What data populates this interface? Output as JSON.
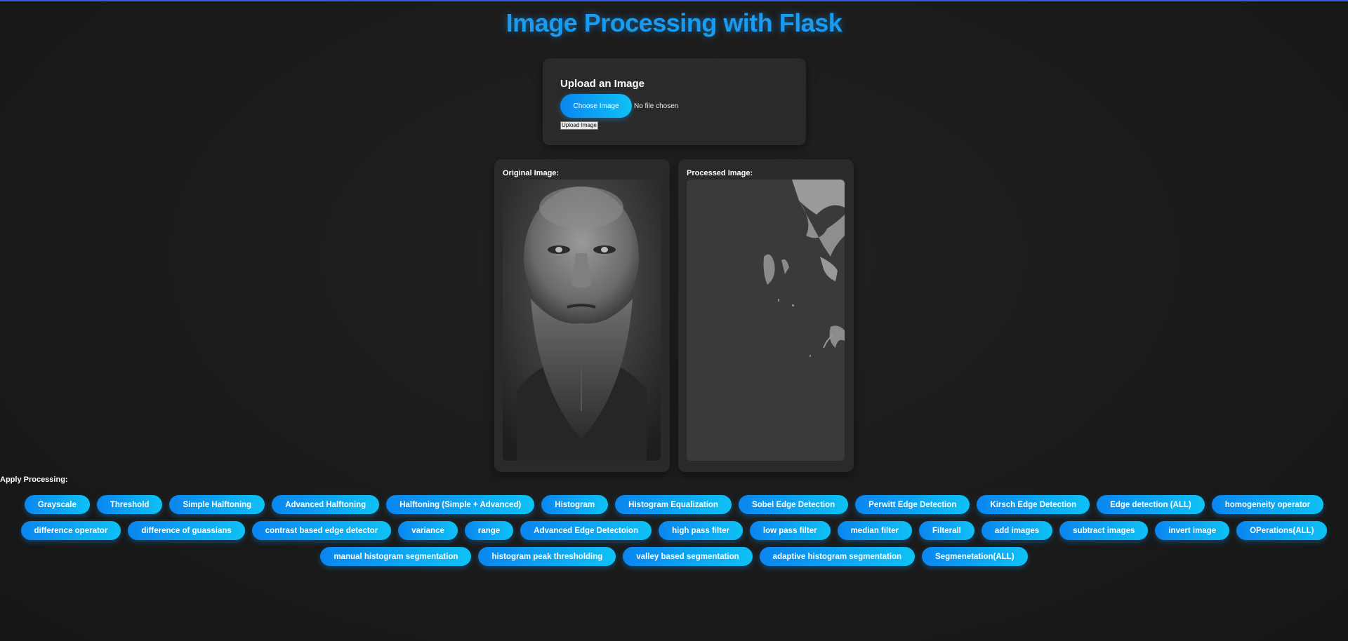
{
  "header": {
    "title": "Image Processing with Flask"
  },
  "upload": {
    "title": "Upload an Image",
    "choose_label": "Choose Image",
    "file_status": "No file chosen",
    "submit_label": "Upload Image"
  },
  "images": {
    "original_label": "Original Image:",
    "processed_label": "Processed Image:"
  },
  "processing": {
    "label": "Apply Processing:",
    "row1": [
      "Grayscale",
      "Threshold",
      "Simple Halftoning",
      "Advanced Halftoning",
      "Halftoning (Simple + Advanced)",
      "Histogram",
      "Histogram Equalization",
      "Sobel Edge Detection",
      "Perwitt Edge Detection",
      "Kirsch Edge Detection",
      "Edge detection (ALL)",
      "homogeneity operator"
    ],
    "row2": [
      "difference operator",
      "difference of guassians",
      "contrast based edge detector",
      "variance",
      "range",
      "Advanced Edge Detectoion",
      "high pass filter",
      "low pass filter",
      "median filter",
      "Filterall",
      "add images",
      "subtract images",
      "invert image",
      "OPerations(ALL)"
    ],
    "row3": [
      "manual histogram segmentation",
      "histogram peak thresholding",
      "valley based segmentation",
      "adaptive histogram segmentation",
      "Segmenetation(ALL)"
    ]
  },
  "colors": {
    "accent": "#1a9bf0",
    "button_start": "#0a86f0",
    "button_end": "#0fc1f5",
    "card": "#2a2a2a"
  }
}
